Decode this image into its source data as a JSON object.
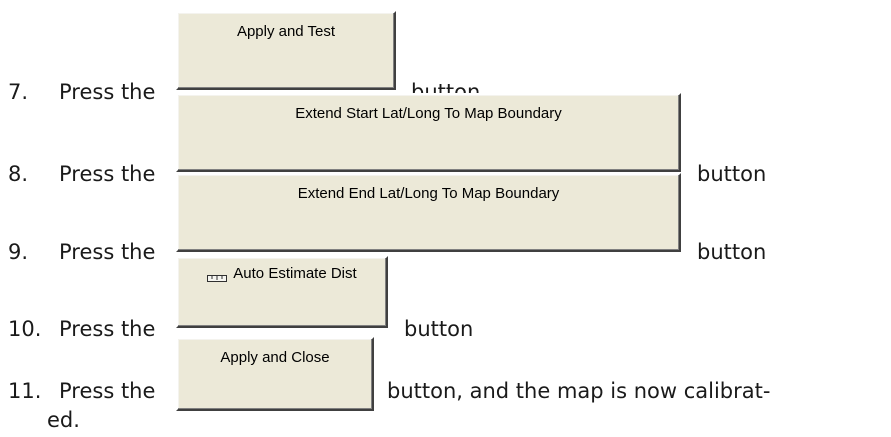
{
  "steps": [
    {
      "number": "7.",
      "prefix": "Press the",
      "button_label": "Apply and Test",
      "suffix": "button"
    },
    {
      "number": "8.",
      "prefix": "Press the",
      "button_label": "Extend Start Lat/Long To Map Boundary",
      "suffix": "button"
    },
    {
      "number": "9.",
      "prefix": "Press the",
      "button_label": "Extend End Lat/Long To Map Boundary",
      "suffix": "button"
    },
    {
      "number": "10.",
      "prefix": "Press the",
      "button_label": "Auto Estimate Dist",
      "button_icon": "ruler-icon",
      "suffix": "button"
    },
    {
      "number": "11.",
      "prefix": "Press the",
      "button_label": "Apply and Close",
      "suffix": "button, and the map is now calibrat-",
      "continuation": "ed."
    }
  ],
  "colors": {
    "button_face": "#ece9d8",
    "text": "#1a1a1a"
  }
}
